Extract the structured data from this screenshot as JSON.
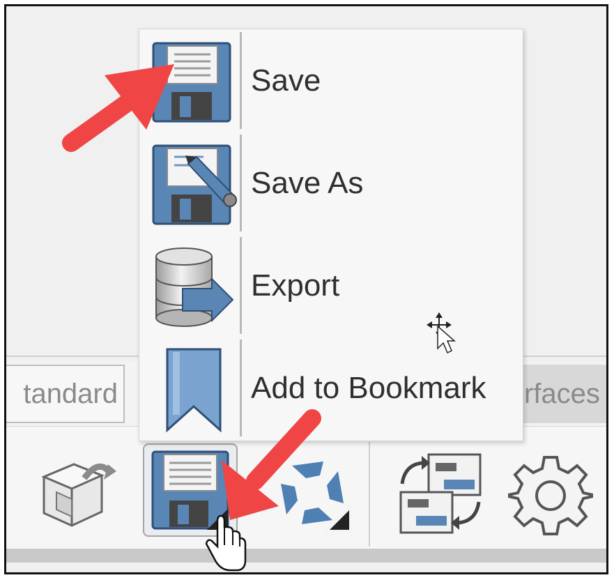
{
  "menu": {
    "items": [
      {
        "label": "Save",
        "icon": "save-icon"
      },
      {
        "label": "Save As",
        "icon": "save-as-icon"
      },
      {
        "label": "Export",
        "icon": "export-icon"
      },
      {
        "label": "Add to Bookmark",
        "icon": "bookmark-icon"
      }
    ]
  },
  "tabs": [
    {
      "label": "tandard"
    },
    {
      "label": "rfaces"
    }
  ],
  "toolbar": {
    "icons": [
      "part-rebuild-icon",
      "save-icon",
      "rotate-refresh-icon",
      "swap-views-icon",
      "gear-icon"
    ]
  },
  "colors": {
    "arrow": "#f04545",
    "disk_blue": "#5a86b5",
    "menu_bg": "#f7f7f7"
  }
}
